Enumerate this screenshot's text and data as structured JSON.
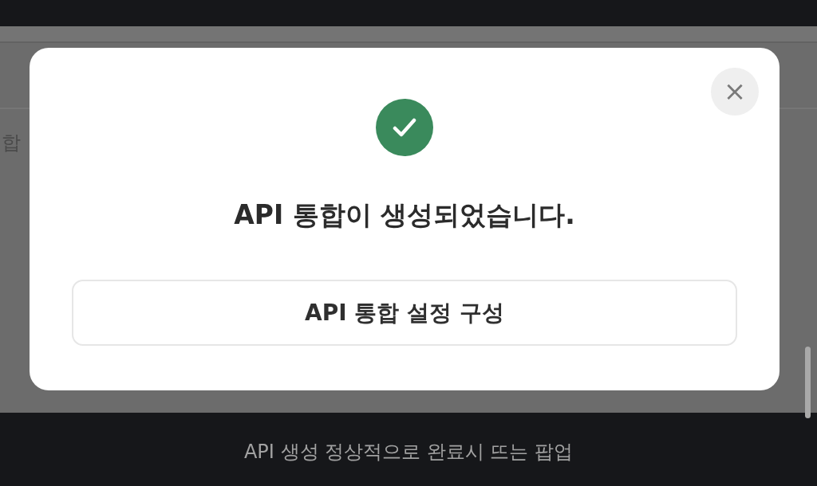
{
  "background_page": {
    "section_label": "합"
  },
  "dialog": {
    "kind": "success",
    "title": "API 통합이 생성되었습니다.",
    "close_label": "×",
    "action_button": "API 통합 설정 구성"
  },
  "caption": "API 생성 정상적으로 완료시 뜨는 팝업"
}
